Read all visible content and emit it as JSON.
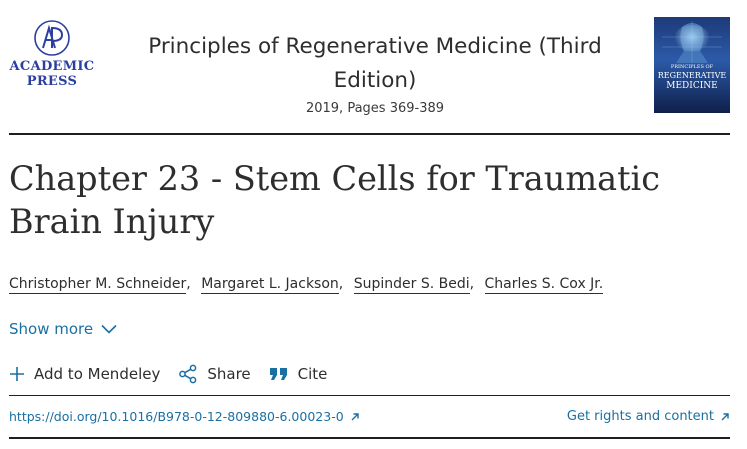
{
  "header": {
    "publisher": {
      "line1": "ACADEMIC",
      "line2": "PRESS",
      "logo_icon": "academic-press-logo-icon"
    },
    "book_title": "Principles of Regenerative Medicine (Third Edition)",
    "book_meta": "2019, Pages 369-389",
    "cover": {
      "line1": "PRINCIPLES OF",
      "line2": "REGENERATIVE",
      "line3": "MEDICINE"
    }
  },
  "chapter": {
    "title": "Chapter 23 - Stem Cells for Traumatic Brain Injury",
    "authors": [
      "Christopher M. Schneider",
      "Margaret L. Jackson",
      "Supinder S. Bedi",
      "Charles S. Cox Jr."
    ],
    "show_more": "Show more"
  },
  "actions": {
    "add": "Add to Mendeley",
    "share": "Share",
    "cite": "Cite"
  },
  "links": {
    "doi": "https://doi.org/10.1016/B978-0-12-809880-6.00023-0",
    "rights": "Get rights and content"
  },
  "colors": {
    "link": "#1a6fa3",
    "publisher": "#2b3fa0",
    "text": "#2e2e2e"
  }
}
